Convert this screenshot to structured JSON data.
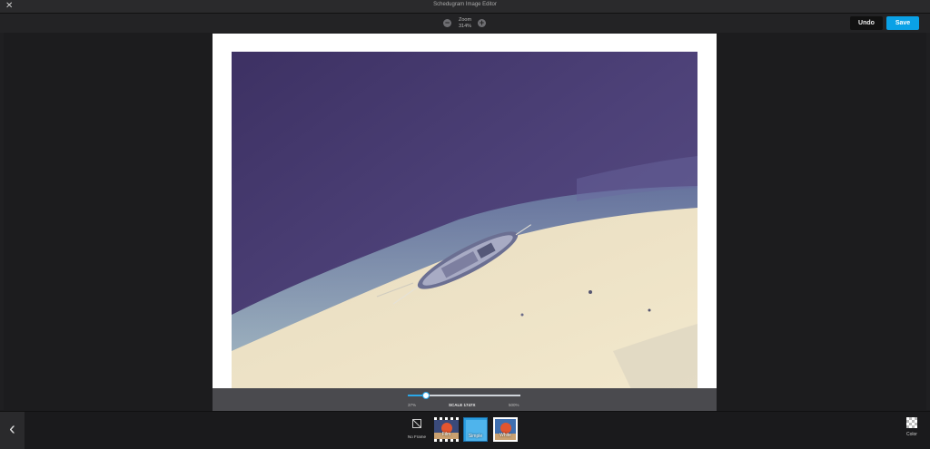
{
  "window": {
    "title": "Schedugram Image Editor"
  },
  "toolbar": {
    "zoom_label": "Zoom",
    "zoom_value": "314%",
    "zoom_out_symbol": "−",
    "zoom_in_symbol": "+",
    "undo_label": "Undo",
    "save_label": "Save"
  },
  "scale": {
    "min_label": "37%",
    "label": "SCALE 1747X",
    "max_label": "500%",
    "value_fraction": 0.16
  },
  "frames": {
    "back_symbol": "‹",
    "options": [
      {
        "label": "No Frame"
      },
      {
        "label": "Film"
      },
      {
        "label": "Simple"
      },
      {
        "label": "White"
      }
    ],
    "color_label": "Color"
  },
  "colors": {
    "accent": "#0aa1e6",
    "water": "#4b3f72",
    "sand": "#efe4c4"
  },
  "icons": {
    "close": "close-icon",
    "zoom_out": "minus-circle-icon",
    "zoom_in": "plus-circle-icon",
    "back": "chevron-left-icon",
    "no_frame": "no-frame-icon",
    "color": "checkerboard-icon"
  }
}
